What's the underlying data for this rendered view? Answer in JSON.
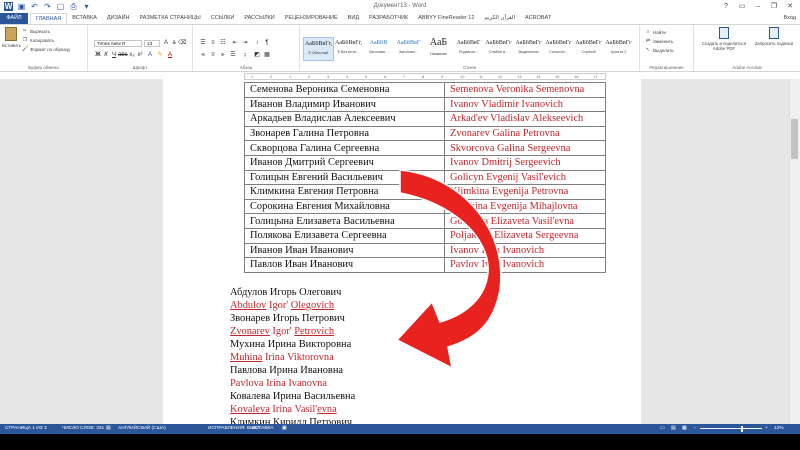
{
  "window": {
    "title": "Документ13 - Word",
    "controls": [
      "?",
      "▭",
      "–",
      "❐",
      "✕"
    ]
  },
  "ribbon": {
    "file_tab": "ФАЙЛ",
    "tabs": [
      "ГЛАВНАЯ",
      "ВСТАВКА",
      "ДИЗАЙН",
      "РАЗМЕТКА СТРАНИЦЫ",
      "ССЫЛКИ",
      "РАССЫЛКИ",
      "РЕЦЕНЗИРОВАНИЕ",
      "ВИД",
      "РАЗРАБОТЧИК",
      "ABBYY FineReader 12",
      "القرآن الكريم",
      "ACROBAT"
    ],
    "active_tab": "ГЛАВНАЯ",
    "user": "Вход",
    "clipboard": {
      "paste_label": "Вставить",
      "cut": "Вырезать",
      "copy": "Копировать",
      "format_painter": "Формат по образцу",
      "group": "Буфер обмена"
    },
    "font": {
      "name": "Times New R",
      "size": "13",
      "group": "Шрифт"
    },
    "paragraph": {
      "group": "Абзац"
    },
    "styles": {
      "group": "Стили",
      "items": [
        {
          "preview": "АаБбВвГг,",
          "name": "¶ Обычный"
        },
        {
          "preview": "АаБбВвГг,",
          "name": "¶ Без инте..."
        },
        {
          "preview": "АаБбВ",
          "name": "Заголово..."
        },
        {
          "preview": "АаБбВвГ",
          "name": "Заголово..."
        },
        {
          "preview": "АаБ",
          "name": "Название"
        },
        {
          "preview": "АаБбВвГ",
          "name": "Подзагол..."
        },
        {
          "preview": "АаБбВвГг",
          "name": "Слабое в..."
        },
        {
          "preview": "АаБбВвГг",
          "name": "Выделение"
        },
        {
          "preview": "АаБбВвГг",
          "name": "Сильное..."
        },
        {
          "preview": "АаБбВвГг",
          "name": "Строгий"
        },
        {
          "preview": "АаБбВвГг",
          "name": "Цитата 2"
        }
      ]
    },
    "editing": {
      "find": "Найти",
      "replace": "Заменить",
      "select": "Выделить",
      "group": "Редактирование"
    },
    "acrobat": {
      "create_pdf": "Создать и поделиться Adobe PDF",
      "request_sign": "Запросить подписи",
      "group": "Adobe Acrobat"
    }
  },
  "ruler": {
    "numbers": [
      "1",
      "2",
      "1",
      "2",
      "3",
      "4",
      "5",
      "6",
      "7",
      "8",
      "9",
      "10",
      "11",
      "12",
      "13",
      "14",
      "15",
      "16",
      "17"
    ]
  },
  "document": {
    "table_rows": [
      {
        "ru": "Семенова Вероника Семеновна",
        "lat": "Semenova Veronika Semenovna"
      },
      {
        "ru": "Иванов Владимир Иванович",
        "lat": "Ivanov Vladimir Ivanovich"
      },
      {
        "ru": "Аркадьев Владислав Алексеевич",
        "lat": "Arkad'ev Vladislav Alekseevich"
      },
      {
        "ru": "Звонарев Галина Петровна",
        "lat": "Zvonarev Galina Petrovna"
      },
      {
        "ru": "Скворцова Галина Сергеевна",
        "lat": "Skvorcova Galina Sergeevna"
      },
      {
        "ru": "Иванов Дмитрий Сергеевич",
        "lat": "Ivanov Dmitrij Sergeevich"
      },
      {
        "ru": "Голицын Евгений Васильевич",
        "lat": "Golicyn Evgenij Vasil'evich"
      },
      {
        "ru": "Климкина Евгения Петровна",
        "lat": "Klimkina Evgenija Petrovna"
      },
      {
        "ru": "Сорокина Евгения Михайловна",
        "lat": "Sorokina Evgenija Mihajlovna"
      },
      {
        "ru": "Голицына Елизавета Васильевна",
        "lat": "Golicyna Elizaveta Vasil'evna"
      },
      {
        "ru": "Полякова Елизавета Сергеевна",
        "lat": "Poljakova Elizaveta Sergeevna"
      },
      {
        "ru": "Иванов Иван Иванович",
        "lat": "Ivanov Ivan Ivanovich"
      },
      {
        "ru": "Павлов Иван Иванович",
        "lat": "Pavlov Ivan Ivanovich"
      }
    ],
    "paragraphs": [
      {
        "ru": "Абдулов Игорь Олегович",
        "lat_a": "Abdulov",
        "lat_b": "Igor'",
        "lat_c": "Olegovich"
      },
      {
        "ru": "Звонарев Игорь Петрович",
        "lat_a": "Zvonarev",
        "lat_b": "Igor'",
        "lat_c": "Petrovich"
      },
      {
        "ru": "Мухина Ирина Викторовна",
        "lat_a": "Muhina",
        "lat_b": "Irina",
        "lat_c": "Viktorovna"
      },
      {
        "ru": "Павлова Ирина Ивановна",
        "lat_a": "Pavlova",
        "lat_b": "Irina",
        "lat_c": "Ivanovna"
      },
      {
        "ru": "Ковалева Ирина Васильевна",
        "lat_a": "Kovaleva",
        "lat_b": "Irina",
        "lat_c": "Vasil'evna"
      },
      {
        "ru": "Климкин Кирилл Петрович",
        "lat_a": "",
        "lat_b": "",
        "lat_c": ""
      }
    ]
  },
  "status": {
    "page": "СТРАНИЦА 1 ИЗ 3",
    "words": "ЧИСЛО СЛОВ: 331",
    "language": "АНГЛИЙСКИЙ (США)",
    "track": "ИСПРАВЛЕНИЯ: ВЫКЛ.",
    "insert": "ВСТАВКА",
    "zoom": "12%"
  },
  "colors": {
    "accent": "#2b579a",
    "arrow": "#e8231f",
    "latin_text": "#c0282d"
  }
}
